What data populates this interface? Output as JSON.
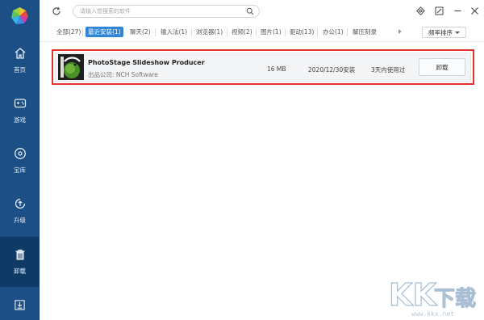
{
  "sidebar": {
    "items": [
      {
        "label": "首页",
        "icon": "home-icon",
        "active": false
      },
      {
        "label": "游戏",
        "icon": "gamepad-icon",
        "active": false
      },
      {
        "label": "宝库",
        "icon": "disc-icon",
        "active": false
      },
      {
        "label": "升级",
        "icon": "upgrade-icon",
        "active": false
      },
      {
        "label": "卸载",
        "icon": "trash-icon",
        "active": true
      }
    ],
    "bottom_icon": "download-icon"
  },
  "toolbar": {
    "search_placeholder": "请输入想搜索的软件"
  },
  "tabs": [
    {
      "label": "全部(27)"
    },
    {
      "label": "最近安装(1)",
      "active": true
    },
    {
      "label": "聊天(2)"
    },
    {
      "label": "输入法(1)"
    },
    {
      "label": "浏览器(1)"
    },
    {
      "label": "视频(2)"
    },
    {
      "label": "图片(1)"
    },
    {
      "label": "驱动(13)"
    },
    {
      "label": "办公(1)"
    },
    {
      "label": "解压刻录"
    }
  ],
  "sort": {
    "label": "频率排序"
  },
  "apps": [
    {
      "name": "PhotoStage Slideshow Producer",
      "publisher": "出品公司: NCH Software",
      "size": "16 MB",
      "install_date": "2020/12/30安装",
      "last_used": "3天内使用过",
      "action_label": "卸载"
    }
  ],
  "watermark": {
    "text": "KK下载",
    "url": "www.kkx.net"
  },
  "colors": {
    "sidebar": "#1b4f86",
    "sidebar_active": "#0f3a66",
    "accent": "#2f86d6",
    "highlight": "#e53030"
  }
}
